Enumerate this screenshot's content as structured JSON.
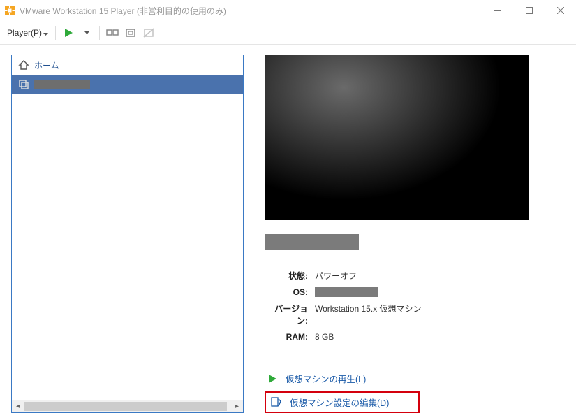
{
  "title": "VMware Workstation 15 Player (非営利目的の使用のみ)",
  "menu": {
    "player": "Player(P)"
  },
  "sidebar": {
    "home": "ホーム",
    "selected_vm": ""
  },
  "details": {
    "props": {
      "state_label": "状態:",
      "state_value": "パワーオフ",
      "os_label": "OS:",
      "os_value": "",
      "version_label": "バージョン:",
      "version_value": "Workstation 15.x 仮想マシン",
      "ram_label": "RAM:",
      "ram_value": "8 GB"
    },
    "actions": {
      "play": "仮想マシンの再生(L)",
      "edit": "仮想マシン設定の編集(D)"
    }
  }
}
